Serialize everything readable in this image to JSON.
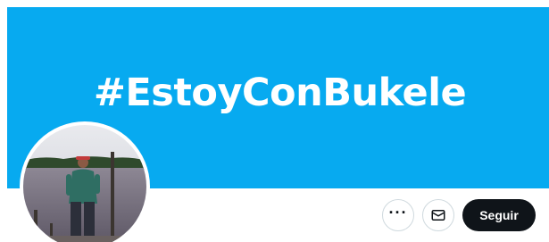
{
  "banner": {
    "text": "#EstoyConBukele",
    "background_color": "#07aaf0"
  },
  "avatar": {
    "description": "profile photo"
  },
  "actions": {
    "more_icon": "more-horizontal-icon",
    "more_label": "···",
    "message_icon": "envelope-icon",
    "follow_label": "Seguir"
  },
  "colors": {
    "follow_button_bg": "#0f1419",
    "follow_button_text": "#ffffff",
    "button_border": "#cfd9de"
  }
}
